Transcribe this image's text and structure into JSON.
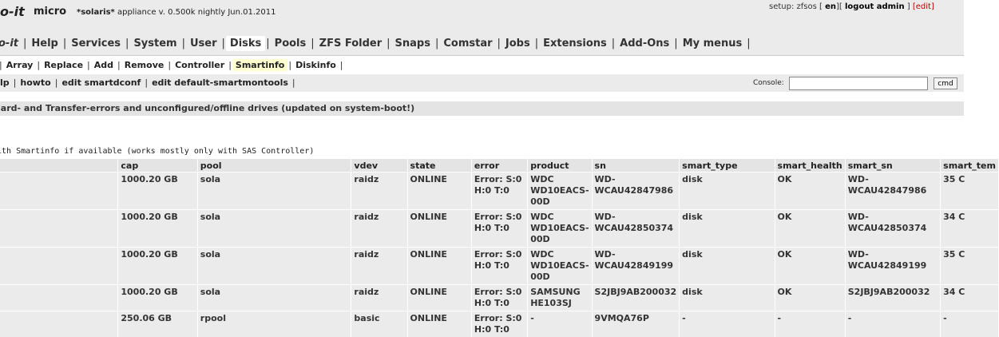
{
  "header": {
    "brand": "o-it",
    "micro": "micro",
    "appliance_name": "*solaris*",
    "appliance_info": "appliance v. 0.500k nightly Jun.01.2011",
    "setup_prefix": "setup: zfsos [",
    "lang": "en",
    "sep1": "][",
    "logout": "logout admin",
    "sep2": "]",
    "edit": "[edit]"
  },
  "main_menu": [
    {
      "label": "o-it",
      "key": "brand"
    },
    {
      "label": "Help"
    },
    {
      "label": "Services"
    },
    {
      "label": "System"
    },
    {
      "label": "User"
    },
    {
      "label": "Disks",
      "active": true
    },
    {
      "label": "Pools"
    },
    {
      "label": "ZFS Folder"
    },
    {
      "label": "Snaps"
    },
    {
      "label": "Comstar"
    },
    {
      "label": "Jobs"
    },
    {
      "label": "Extensions"
    },
    {
      "label": "Add-Ons"
    },
    {
      "label": "My menus"
    }
  ],
  "sub_menu": [
    {
      "label": "Array"
    },
    {
      "label": "Replace"
    },
    {
      "label": "Add"
    },
    {
      "label": "Remove"
    },
    {
      "label": "Controller"
    },
    {
      "label": "Smartinfo",
      "active": true
    },
    {
      "label": "Diskinfo"
    }
  ],
  "third_menu": [
    {
      "label": "lp"
    },
    {
      "label": "howto"
    },
    {
      "label": "edit smartdconf"
    },
    {
      "label": "edit default-smartmontools"
    }
  ],
  "console": {
    "label": "Console:",
    "value": "",
    "button": "cmd"
  },
  "notice": "lard- and Transfer-errors and unconfigured/offline drives (updated on system-boot!)",
  "smart_note": "ith Smartinfo if available (works mostly only with SAS Controller)",
  "table": {
    "columns": [
      "",
      "cap",
      "pool",
      "vdev",
      "state",
      "error",
      "product",
      "sn",
      "smart_type",
      "smart_health",
      "smart_sn",
      "smart_tem"
    ],
    "rows": [
      [
        "",
        "1000.20 GB",
        "sola",
        "raidz",
        "ONLINE",
        "Error: S:0 H:0 T:0",
        "WDC WD10EACS-00D",
        "WD-WCAU42847986",
        "disk",
        "OK",
        "WD-WCAU42847986",
        "35 C"
      ],
      [
        "",
        "1000.20 GB",
        "sola",
        "raidz",
        "ONLINE",
        "Error: S:0 H:0 T:0",
        "WDC WD10EACS-00D",
        "WD-WCAU42850374",
        "disk",
        "OK",
        "WD-WCAU42850374",
        "34 C"
      ],
      [
        "",
        "1000.20 GB",
        "sola",
        "raidz",
        "ONLINE",
        "Error: S:0 H:0 T:0",
        "WDC WD10EACS-00D",
        "WD-WCAU42849199",
        "disk",
        "OK",
        "WD-WCAU42849199",
        "35 C"
      ],
      [
        "",
        "1000.20 GB",
        "sola",
        "raidz",
        "ONLINE",
        "Error: S:0 H:0 T:0",
        "SAMSUNG HE103SJ",
        "S2JBJ9AB200032",
        "disk",
        "OK",
        "S2JBJ9AB200032",
        "34 C"
      ],
      [
        "",
        "250.06 GB",
        "rpool",
        "basic",
        "ONLINE",
        "Error: S:0 H:0 T:0",
        "-",
        "9VMQA76P",
        "-",
        "-",
        "-",
        "-"
      ]
    ]
  }
}
